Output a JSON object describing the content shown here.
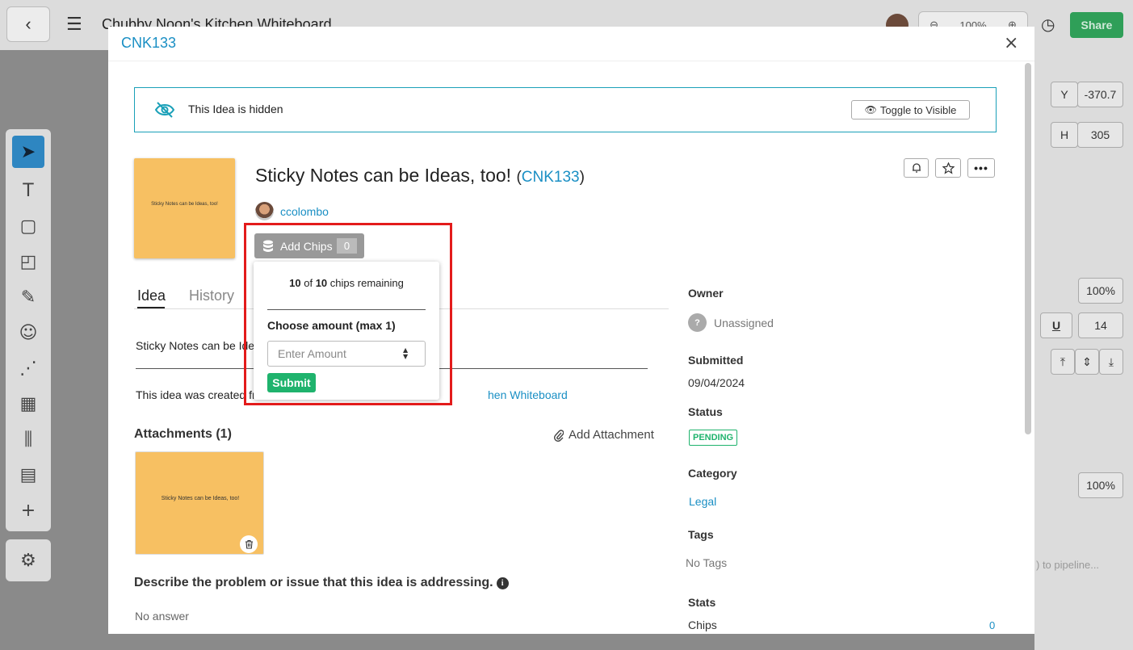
{
  "background": {
    "title": "Chubby Noon's Kitchen Whiteboard",
    "zoom": "100%",
    "share_label": "Share",
    "right_panel": {
      "y_label": "Y",
      "y_value": "-370.7",
      "h_label": "H",
      "h_value": "305",
      "opacity1": "100%",
      "font_size": "14",
      "opacity2": "100%",
      "pipeline_hint": ") to pipeline..."
    }
  },
  "modal": {
    "id": "CNK133",
    "close": "×",
    "hidden_banner": {
      "text": "This Idea is hidden",
      "button": "Toggle to Visible"
    },
    "thumbnail_text": "Sticky Notes can be Ideas, too!",
    "title": "Sticky Notes can be Ideas, too!",
    "title_code": "CNK133",
    "author": "ccolombo",
    "chips_button": {
      "label": "Add Chips",
      "count": "0"
    },
    "chips_popup": {
      "remaining_num": "10",
      "remaining_of": "of",
      "remaining_total": "10",
      "remaining_suffix": "chips remaining",
      "choose_label": "Choose amount (max 1)",
      "placeholder": "Enter Amount",
      "submit": "Submit"
    },
    "tabs": [
      "Idea",
      "History"
    ],
    "description": "Sticky Notes can be Idea",
    "created_prefix": "This idea was created fro",
    "created_link": "hen Whiteboard",
    "attachments": {
      "heading": "Attachments (1)",
      "add": "Add Attachment",
      "image_text": "Sticky Notes can be Ideas, too!"
    },
    "question": "Describe the problem or issue that this idea is addressing.",
    "no_answer": "No answer",
    "sidebar": {
      "owner_label": "Owner",
      "owner_value": "Unassigned",
      "submitted_label": "Submitted",
      "submitted_value": "09/04/2024",
      "status_label": "Status",
      "status_value": "PENDING",
      "category_label": "Category",
      "category_value": "Legal",
      "tags_label": "Tags",
      "tags_value": "No Tags",
      "stats_label": "Stats",
      "chips_label": "Chips",
      "chips_value": "0"
    }
  },
  "colors": {
    "accent": "#1a8fc4",
    "success": "#1fb36d",
    "highlight": "#e31b1b",
    "sticky": "#f7c062"
  }
}
